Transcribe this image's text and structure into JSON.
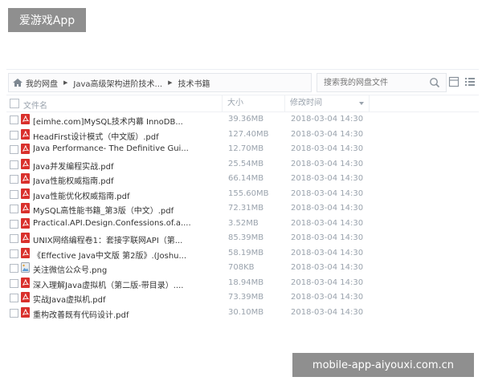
{
  "watermarks": {
    "top": "爱游戏App",
    "bottom": "mobile-app-aiyouxi.com.cn"
  },
  "breadcrumb": {
    "items": [
      "我的网盘",
      "Java高级架构进阶技术...",
      "技术书籍"
    ]
  },
  "search": {
    "placeholder": "搜索我的网盘文件"
  },
  "icons": {
    "home": "home-icon",
    "search": "search-icon",
    "list_view": "list-view-icon",
    "grid_view": "grid-view-icon",
    "pdf": "pdf-icon",
    "image": "image-icon"
  },
  "colors": {
    "pdf_icon": "#d9302c",
    "text": "#333333",
    "muted": "#9aa3ad",
    "watermark_bg": "#8f8f8f"
  },
  "table": {
    "columns": {
      "name": "文件名",
      "size": "大小",
      "modified": "修改时间"
    },
    "rows": [
      {
        "name": "[eimhe.com]MySQL技术内幕  InnoDB...",
        "size": "39.36MB",
        "time": "2018-03-04 14:30",
        "type": "pdf"
      },
      {
        "name": "HeadFirst设计模式（中文版）.pdf",
        "size": "127.40MB",
        "time": "2018-03-04 14:30",
        "type": "pdf"
      },
      {
        "name": "Java Performance- The Definitive Gui...",
        "size": "12.70MB",
        "time": "2018-03-04 14:30",
        "type": "pdf"
      },
      {
        "name": "Java并发编程实战.pdf",
        "size": "25.54MB",
        "time": "2018-03-04 14:30",
        "type": "pdf"
      },
      {
        "name": "Java性能权威指南.pdf",
        "size": "66.14MB",
        "time": "2018-03-04 14:30",
        "type": "pdf"
      },
      {
        "name": "Java性能优化权威指南.pdf",
        "size": "155.60MB",
        "time": "2018-03-04 14:30",
        "type": "pdf"
      },
      {
        "name": "MySQL高性能书籍_第3版（中文）.pdf",
        "size": "72.31MB",
        "time": "2018-03-04 14:30",
        "type": "pdf"
      },
      {
        "name": "Practical.API.Design.Confessions.of.a....",
        "size": "3.52MB",
        "time": "2018-03-04 14:30",
        "type": "pdf"
      },
      {
        "name": "UNIX网络编程卷1：套接字联网API（第...",
        "size": "85.39MB",
        "time": "2018-03-04 14:30",
        "type": "pdf"
      },
      {
        "name": "《Effective Java中文版 第2版》.(Joshu...",
        "size": "58.19MB",
        "time": "2018-03-04 14:30",
        "type": "pdf"
      },
      {
        "name": "关注微信公众号.png",
        "size": "708KB",
        "time": "2018-03-04 14:30",
        "type": "image"
      },
      {
        "name": "深入理解Java虚拟机（第二版-带目录）....",
        "size": "18.94MB",
        "time": "2018-03-04 14:30",
        "type": "pdf"
      },
      {
        "name": "实战Java虚拟机.pdf",
        "size": "73.39MB",
        "time": "2018-03-04 14:30",
        "type": "pdf"
      },
      {
        "name": "重构改善既有代码设计.pdf",
        "size": "30.10MB",
        "time": "2018-03-04 14:30",
        "type": "pdf"
      }
    ]
  }
}
